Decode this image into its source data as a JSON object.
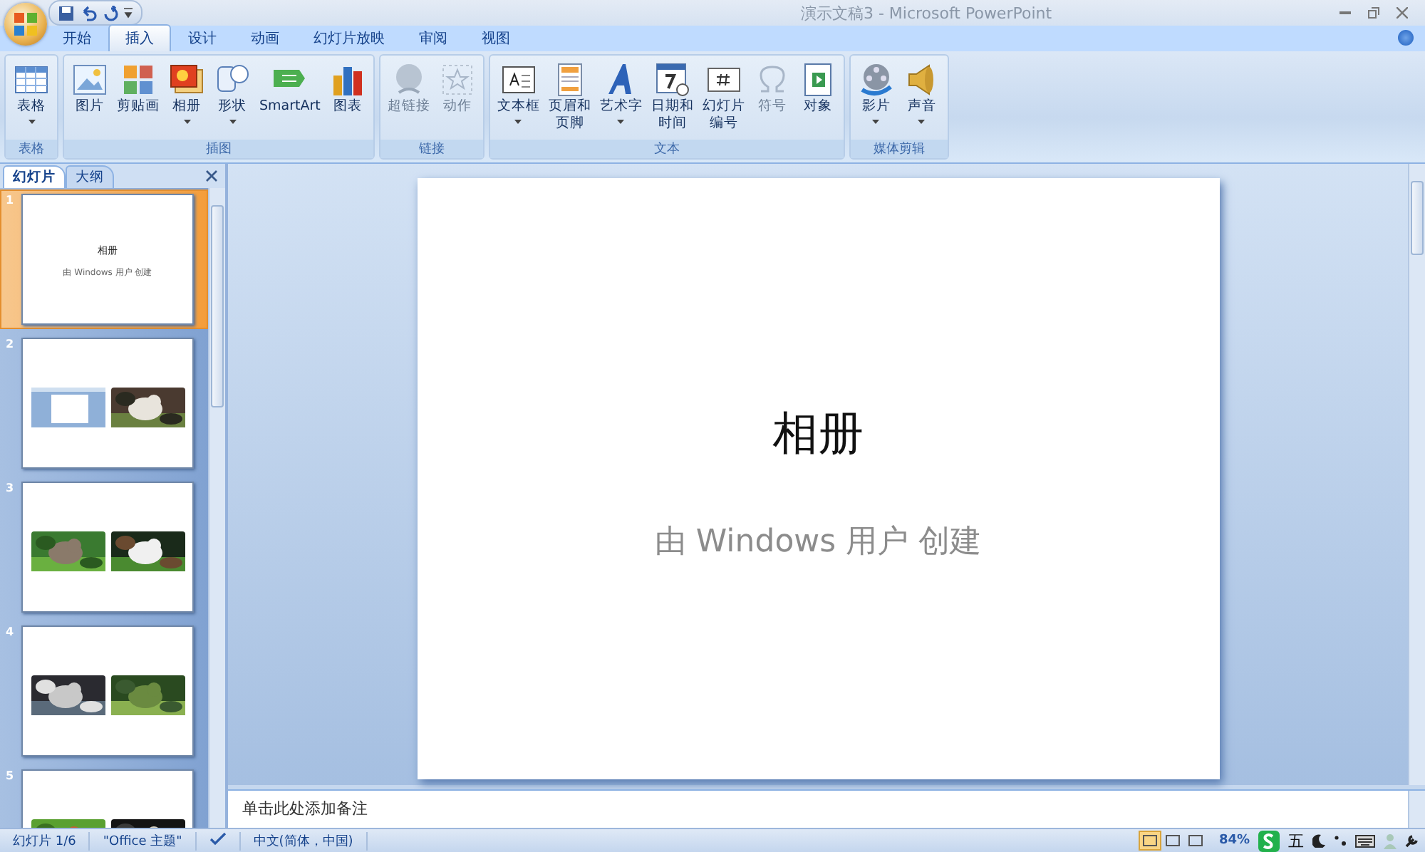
{
  "window": {
    "title": "演示文稿3 - Microsoft PowerPoint"
  },
  "ribbon": {
    "tabs": [
      {
        "label": "开始",
        "selected": false
      },
      {
        "label": "插入",
        "selected": true
      },
      {
        "label": "设计",
        "selected": false
      },
      {
        "label": "动画",
        "selected": false
      },
      {
        "label": "幻灯片放映",
        "selected": false
      },
      {
        "label": "审阅",
        "selected": false
      },
      {
        "label": "视图",
        "selected": false
      }
    ],
    "groups": [
      {
        "label": "表格",
        "buttons": [
          {
            "label": "表格",
            "dropdown": true,
            "disabled": false
          }
        ]
      },
      {
        "label": "插图",
        "buttons": [
          {
            "label": "图片",
            "dropdown": false,
            "disabled": false
          },
          {
            "label": "剪贴画",
            "dropdown": false,
            "disabled": false
          },
          {
            "label": "相册",
            "dropdown": true,
            "disabled": false
          },
          {
            "label": "形状",
            "dropdown": true,
            "disabled": false
          },
          {
            "label": "SmartArt",
            "dropdown": false,
            "disabled": false
          },
          {
            "label": "图表",
            "dropdown": false,
            "disabled": false
          }
        ]
      },
      {
        "label": "链接",
        "buttons": [
          {
            "label": "超链接",
            "dropdown": false,
            "disabled": true
          },
          {
            "label": "动作",
            "dropdown": false,
            "disabled": true
          }
        ]
      },
      {
        "label": "文本",
        "buttons": [
          {
            "label": "文本框",
            "dropdown": true,
            "disabled": false
          },
          {
            "label": "页眉和",
            "label_line_2": "页脚",
            "dropdown": false,
            "disabled": false
          },
          {
            "label": "艺术字",
            "dropdown": true,
            "disabled": false
          },
          {
            "label": "日期和",
            "label_line_2": "时间",
            "dropdown": false,
            "disabled": false
          },
          {
            "label": "幻灯片",
            "label_line_2": "编号",
            "dropdown": false,
            "disabled": false
          },
          {
            "label": "符号",
            "dropdown": false,
            "disabled": true
          },
          {
            "label": "对象",
            "dropdown": false,
            "disabled": false
          }
        ]
      },
      {
        "label": "媒体剪辑",
        "buttons": [
          {
            "label": "影片",
            "dropdown": true,
            "disabled": false
          },
          {
            "label": "声音",
            "dropdown": true,
            "disabled": false
          }
        ]
      }
    ]
  },
  "slides_panel": {
    "tabs": [
      {
        "label": "幻灯片",
        "selected": true
      },
      {
        "label": "大纲",
        "selected": false
      }
    ],
    "slides": [
      {
        "number": "1",
        "selected": true,
        "kind": "title",
        "title": "相册",
        "subtitle": "由 Windows 用户 创建"
      },
      {
        "number": "2",
        "selected": false,
        "kind": "pictures",
        "pictures": [
          {
            "kind": "screenshot"
          },
          {
            "kind": "picture"
          }
        ]
      },
      {
        "number": "3",
        "selected": false,
        "kind": "pictures",
        "pictures": [
          {
            "kind": "picture"
          },
          {
            "kind": "picture"
          }
        ]
      },
      {
        "number": "4",
        "selected": false,
        "kind": "pictures",
        "pictures": [
          {
            "kind": "picture"
          },
          {
            "kind": "picture"
          }
        ]
      },
      {
        "number": "5",
        "selected": false,
        "kind": "pictures",
        "pictures": [
          {
            "kind": "picture"
          },
          {
            "kind": "picture"
          }
        ]
      }
    ]
  },
  "slide": {
    "title": "相册",
    "subtitle": "由 Windows 用户 创建"
  },
  "notes": {
    "placeholder": "单击此处添加备注"
  },
  "status_bar": {
    "slide_info": "幻灯片 1/6",
    "theme": "\"Office 主题\"",
    "language": "中文(简体，中国)",
    "views": [
      {
        "selected": true
      },
      {
        "selected": false
      },
      {
        "selected": false
      }
    ],
    "zoom": "84%",
    "ime_mode": "五"
  }
}
